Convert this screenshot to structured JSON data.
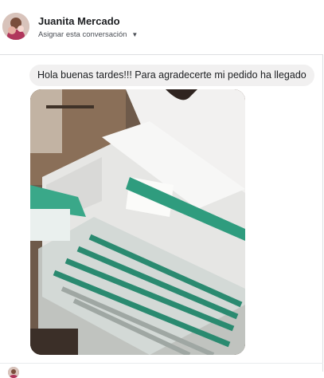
{
  "conversation": {
    "contact_name": "Juanita Mercado",
    "assign_label": "Asignar esta conversación",
    "assign_icon": "chevron-down-icon"
  },
  "messages": [
    {
      "text": "Hola buenas tardes!!! Para agradecerte mi pedido ha llegado",
      "attachment": "photo"
    }
  ]
}
